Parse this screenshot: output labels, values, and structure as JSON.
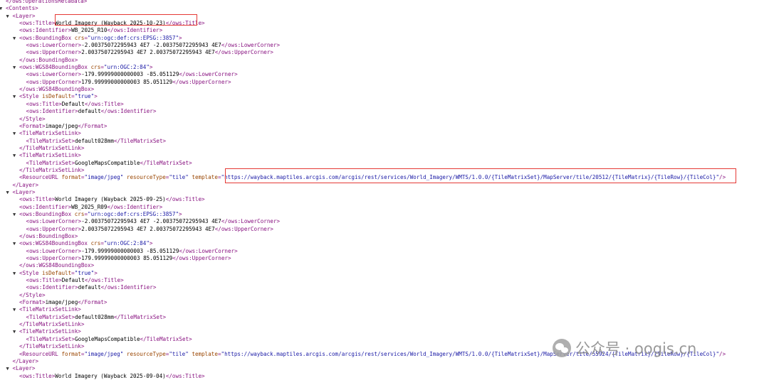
{
  "colors": {
    "tag": "#881280",
    "attribute": "#994500",
    "attribute_value": "#1a1aa6",
    "text": "#000000",
    "highlight": "#e53935"
  },
  "watermark": {
    "icon": "wechat-icon",
    "text": "公众号 · oogis.cn"
  },
  "lines": [
    {
      "indent": 0,
      "arrow": "",
      "tokens": [
        {
          "t": "tag",
          "v": "</ows:OperationsMetadata>"
        }
      ]
    },
    {
      "indent": 0,
      "arrow": "▼",
      "tokens": [
        {
          "t": "tag",
          "v": "<Contents>"
        }
      ]
    },
    {
      "indent": 1,
      "arrow": "▼",
      "tokens": [
        {
          "t": "tag",
          "v": "<Layer>"
        }
      ]
    },
    {
      "indent": 2,
      "arrow": "",
      "tokens": [
        {
          "t": "tag",
          "v": "<ows:Title>"
        },
        {
          "t": "txt",
          "v": "World Imagery (Wayback 2025-10-23)"
        },
        {
          "t": "tag",
          "v": "</ows:Title>"
        }
      ]
    },
    {
      "indent": 2,
      "arrow": "",
      "tokens": [
        {
          "t": "tag",
          "v": "<ows:Identifier>"
        },
        {
          "t": "txt",
          "v": "WB_2025_R10"
        },
        {
          "t": "tag",
          "v": "</ows:Identifier>"
        }
      ]
    },
    {
      "indent": 2,
      "arrow": "▼",
      "tokens": [
        {
          "t": "tag",
          "v": "<ows:BoundingBox "
        },
        {
          "t": "attr",
          "v": "crs"
        },
        {
          "t": "tag",
          "v": "="
        },
        {
          "t": "val",
          "v": "\"urn:ogc:def:crs:EPSG::3857\""
        },
        {
          "t": "tag",
          "v": ">"
        }
      ]
    },
    {
      "indent": 3,
      "arrow": "",
      "tokens": [
        {
          "t": "tag",
          "v": "<ows:LowerCorner>"
        },
        {
          "t": "txt",
          "v": "-2.00375072295943 4E7 -2.00375072295943 4E7"
        },
        {
          "t": "tag",
          "v": "</ows:LowerCorner>"
        }
      ]
    },
    {
      "indent": 3,
      "arrow": "",
      "tokens": [
        {
          "t": "tag",
          "v": "<ows:UpperCorner>"
        },
        {
          "t": "txt",
          "v": "2.00375072295943 4E7 2.00375072295943 4E7"
        },
        {
          "t": "tag",
          "v": "</ows:UpperCorner>"
        }
      ]
    },
    {
      "indent": 2,
      "arrow": "",
      "tokens": [
        {
          "t": "tag",
          "v": "</ows:BoundingBox>"
        }
      ]
    },
    {
      "indent": 2,
      "arrow": "▼",
      "tokens": [
        {
          "t": "tag",
          "v": "<ows:WGS84BoundingBox "
        },
        {
          "t": "attr",
          "v": "crs"
        },
        {
          "t": "tag",
          "v": "="
        },
        {
          "t": "val",
          "v": "\"urn:OGC:2:84\""
        },
        {
          "t": "tag",
          "v": ">"
        }
      ]
    },
    {
      "indent": 3,
      "arrow": "",
      "tokens": [
        {
          "t": "tag",
          "v": "<ows:LowerCorner>"
        },
        {
          "t": "txt",
          "v": "-179.99999000000003 -85.051129"
        },
        {
          "t": "tag",
          "v": "</ows:LowerCorner>"
        }
      ]
    },
    {
      "indent": 3,
      "arrow": "",
      "tokens": [
        {
          "t": "tag",
          "v": "<ows:UpperCorner>"
        },
        {
          "t": "txt",
          "v": "179.99999000000003 85.051129"
        },
        {
          "t": "tag",
          "v": "</ows:UpperCorner>"
        }
      ]
    },
    {
      "indent": 2,
      "arrow": "",
      "tokens": [
        {
          "t": "tag",
          "v": "</ows:WGS84BoundingBox>"
        }
      ]
    },
    {
      "indent": 2,
      "arrow": "▼",
      "tokens": [
        {
          "t": "tag",
          "v": "<Style "
        },
        {
          "t": "attr",
          "v": "isDefault"
        },
        {
          "t": "tag",
          "v": "="
        },
        {
          "t": "val",
          "v": "\"true\""
        },
        {
          "t": "tag",
          "v": ">"
        }
      ]
    },
    {
      "indent": 3,
      "arrow": "",
      "tokens": [
        {
          "t": "tag",
          "v": "<ows:Title>"
        },
        {
          "t": "txt",
          "v": "Default"
        },
        {
          "t": "tag",
          "v": "</ows:Title>"
        }
      ]
    },
    {
      "indent": 3,
      "arrow": "",
      "tokens": [
        {
          "t": "tag",
          "v": "<ows:Identifier>"
        },
        {
          "t": "txt",
          "v": "default"
        },
        {
          "t": "tag",
          "v": "</ows:Identifier>"
        }
      ]
    },
    {
      "indent": 2,
      "arrow": "",
      "tokens": [
        {
          "t": "tag",
          "v": "</Style>"
        }
      ]
    },
    {
      "indent": 2,
      "arrow": "",
      "tokens": [
        {
          "t": "tag",
          "v": "<Format>"
        },
        {
          "t": "txt",
          "v": "image/jpeg"
        },
        {
          "t": "tag",
          "v": "</Format>"
        }
      ]
    },
    {
      "indent": 2,
      "arrow": "▼",
      "tokens": [
        {
          "t": "tag",
          "v": "<TileMatrixSetLink>"
        }
      ]
    },
    {
      "indent": 3,
      "arrow": "",
      "tokens": [
        {
          "t": "tag",
          "v": "<TileMatrixSet>"
        },
        {
          "t": "txt",
          "v": "default028mm"
        },
        {
          "t": "tag",
          "v": "</TileMatrixSet>"
        }
      ]
    },
    {
      "indent": 2,
      "arrow": "",
      "tokens": [
        {
          "t": "tag",
          "v": "</TileMatrixSetLink>"
        }
      ]
    },
    {
      "indent": 2,
      "arrow": "▼",
      "tokens": [
        {
          "t": "tag",
          "v": "<TileMatrixSetLink>"
        }
      ]
    },
    {
      "indent": 3,
      "arrow": "",
      "tokens": [
        {
          "t": "tag",
          "v": "<TileMatrixSet>"
        },
        {
          "t": "txt",
          "v": "GoogleMapsCompatible"
        },
        {
          "t": "tag",
          "v": "</TileMatrixSet>"
        }
      ]
    },
    {
      "indent": 2,
      "arrow": "",
      "tokens": [
        {
          "t": "tag",
          "v": "</TileMatrixSetLink>"
        }
      ]
    },
    {
      "indent": 2,
      "arrow": "",
      "tokens": [
        {
          "t": "tag",
          "v": "<ResourceURL "
        },
        {
          "t": "attr",
          "v": "format"
        },
        {
          "t": "tag",
          "v": "="
        },
        {
          "t": "val",
          "v": "\"image/jpeg\""
        },
        {
          "t": "tag",
          "v": " "
        },
        {
          "t": "attr",
          "v": "resourceType"
        },
        {
          "t": "tag",
          "v": "="
        },
        {
          "t": "val",
          "v": "\"tile\""
        },
        {
          "t": "tag",
          "v": " "
        },
        {
          "t": "attr",
          "v": "template"
        },
        {
          "t": "tag",
          "v": "="
        },
        {
          "t": "val",
          "v": "\"https://wayback.maptiles.arcgis.com/arcgis/rest/services/World_Imagery/WMTS/1.0.0/{TileMatrixSet}/MapServer/tile/20512/{TileMatrix}/{TileRow}/{TileCol}\""
        },
        {
          "t": "tag",
          "v": "/>"
        }
      ]
    },
    {
      "indent": 1,
      "arrow": "",
      "tokens": [
        {
          "t": "tag",
          "v": "</Layer>"
        }
      ]
    },
    {
      "indent": 1,
      "arrow": "▼",
      "tokens": [
        {
          "t": "tag",
          "v": "<Layer>"
        }
      ]
    },
    {
      "indent": 2,
      "arrow": "",
      "tokens": [
        {
          "t": "tag",
          "v": "<ows:Title>"
        },
        {
          "t": "txt",
          "v": "World Imagery (Wayback 2025-09-25)"
        },
        {
          "t": "tag",
          "v": "</ows:Title>"
        }
      ]
    },
    {
      "indent": 2,
      "arrow": "",
      "tokens": [
        {
          "t": "tag",
          "v": "<ows:Identifier>"
        },
        {
          "t": "txt",
          "v": "WB_2025_R09"
        },
        {
          "t": "tag",
          "v": "</ows:Identifier>"
        }
      ]
    },
    {
      "indent": 2,
      "arrow": "▼",
      "tokens": [
        {
          "t": "tag",
          "v": "<ows:BoundingBox "
        },
        {
          "t": "attr",
          "v": "crs"
        },
        {
          "t": "tag",
          "v": "="
        },
        {
          "t": "val",
          "v": "\"urn:ogc:def:crs:EPSG::3857\""
        },
        {
          "t": "tag",
          "v": ">"
        }
      ]
    },
    {
      "indent": 3,
      "arrow": "",
      "tokens": [
        {
          "t": "tag",
          "v": "<ows:LowerCorner>"
        },
        {
          "t": "txt",
          "v": "-2.00375072295943 4E7 -2.00375072295943 4E7"
        },
        {
          "t": "tag",
          "v": "</ows:LowerCorner>"
        }
      ]
    },
    {
      "indent": 3,
      "arrow": "",
      "tokens": [
        {
          "t": "tag",
          "v": "<ows:UpperCorner>"
        },
        {
          "t": "txt",
          "v": "2.00375072295943 4E7 2.00375072295943 4E7"
        },
        {
          "t": "tag",
          "v": "</ows:UpperCorner>"
        }
      ]
    },
    {
      "indent": 2,
      "arrow": "",
      "tokens": [
        {
          "t": "tag",
          "v": "</ows:BoundingBox>"
        }
      ]
    },
    {
      "indent": 2,
      "arrow": "▼",
      "tokens": [
        {
          "t": "tag",
          "v": "<ows:WGS84BoundingBox "
        },
        {
          "t": "attr",
          "v": "crs"
        },
        {
          "t": "tag",
          "v": "="
        },
        {
          "t": "val",
          "v": "\"urn:OGC:2:84\""
        },
        {
          "t": "tag",
          "v": ">"
        }
      ]
    },
    {
      "indent": 3,
      "arrow": "",
      "tokens": [
        {
          "t": "tag",
          "v": "<ows:LowerCorner>"
        },
        {
          "t": "txt",
          "v": "-179.99999000000003 -85.051129"
        },
        {
          "t": "tag",
          "v": "</ows:LowerCorner>"
        }
      ]
    },
    {
      "indent": 3,
      "arrow": "",
      "tokens": [
        {
          "t": "tag",
          "v": "<ows:UpperCorner>"
        },
        {
          "t": "txt",
          "v": "179.99999000000003 85.051129"
        },
        {
          "t": "tag",
          "v": "</ows:UpperCorner>"
        }
      ]
    },
    {
      "indent": 2,
      "arrow": "",
      "tokens": [
        {
          "t": "tag",
          "v": "</ows:WGS84BoundingBox>"
        }
      ]
    },
    {
      "indent": 2,
      "arrow": "▼",
      "tokens": [
        {
          "t": "tag",
          "v": "<Style "
        },
        {
          "t": "attr",
          "v": "isDefault"
        },
        {
          "t": "tag",
          "v": "="
        },
        {
          "t": "val",
          "v": "\"true\""
        },
        {
          "t": "tag",
          "v": ">"
        }
      ]
    },
    {
      "indent": 3,
      "arrow": "",
      "tokens": [
        {
          "t": "tag",
          "v": "<ows:Title>"
        },
        {
          "t": "txt",
          "v": "Default"
        },
        {
          "t": "tag",
          "v": "</ows:Title>"
        }
      ]
    },
    {
      "indent": 3,
      "arrow": "",
      "tokens": [
        {
          "t": "tag",
          "v": "<ows:Identifier>"
        },
        {
          "t": "txt",
          "v": "default"
        },
        {
          "t": "tag",
          "v": "</ows:Identifier>"
        }
      ]
    },
    {
      "indent": 2,
      "arrow": "",
      "tokens": [
        {
          "t": "tag",
          "v": "</Style>"
        }
      ]
    },
    {
      "indent": 2,
      "arrow": "",
      "tokens": [
        {
          "t": "tag",
          "v": "<Format>"
        },
        {
          "t": "txt",
          "v": "image/jpeg"
        },
        {
          "t": "tag",
          "v": "</Format>"
        }
      ]
    },
    {
      "indent": 2,
      "arrow": "▼",
      "tokens": [
        {
          "t": "tag",
          "v": "<TileMatrixSetLink>"
        }
      ]
    },
    {
      "indent": 3,
      "arrow": "",
      "tokens": [
        {
          "t": "tag",
          "v": "<TileMatrixSet>"
        },
        {
          "t": "txt",
          "v": "default028mm"
        },
        {
          "t": "tag",
          "v": "</TileMatrixSet>"
        }
      ]
    },
    {
      "indent": 2,
      "arrow": "",
      "tokens": [
        {
          "t": "tag",
          "v": "</TileMatrixSetLink>"
        }
      ]
    },
    {
      "indent": 2,
      "arrow": "▼",
      "tokens": [
        {
          "t": "tag",
          "v": "<TileMatrixSetLink>"
        }
      ]
    },
    {
      "indent": 3,
      "arrow": "",
      "tokens": [
        {
          "t": "tag",
          "v": "<TileMatrixSet>"
        },
        {
          "t": "txt",
          "v": "GoogleMapsCompatible"
        },
        {
          "t": "tag",
          "v": "</TileMatrixSet>"
        }
      ]
    },
    {
      "indent": 2,
      "arrow": "",
      "tokens": [
        {
          "t": "tag",
          "v": "</TileMatrixSetLink>"
        }
      ]
    },
    {
      "indent": 2,
      "arrow": "",
      "tokens": [
        {
          "t": "tag",
          "v": "<ResourceURL "
        },
        {
          "t": "attr",
          "v": "format"
        },
        {
          "t": "tag",
          "v": "="
        },
        {
          "t": "val",
          "v": "\"image/jpeg\""
        },
        {
          "t": "tag",
          "v": " "
        },
        {
          "t": "attr",
          "v": "resourceType"
        },
        {
          "t": "tag",
          "v": "="
        },
        {
          "t": "val",
          "v": "\"tile\""
        },
        {
          "t": "tag",
          "v": " "
        },
        {
          "t": "attr",
          "v": "template"
        },
        {
          "t": "tag",
          "v": "="
        },
        {
          "t": "val",
          "v": "\"https://wayback.maptiles.arcgis.com/arcgis/rest/services/World_Imagery/WMTS/1.0.0/{TileMatrixSet}/MapServer/tile/55924/{TileMatrix}/{TileRow}/{TileCol}\""
        },
        {
          "t": "tag",
          "v": "/>"
        }
      ]
    },
    {
      "indent": 1,
      "arrow": "",
      "tokens": [
        {
          "t": "tag",
          "v": "</Layer>"
        }
      ]
    },
    {
      "indent": 1,
      "arrow": "▼",
      "tokens": [
        {
          "t": "tag",
          "v": "<Layer>"
        }
      ]
    },
    {
      "indent": 2,
      "arrow": "",
      "tokens": [
        {
          "t": "tag",
          "v": "<ows:Title>"
        },
        {
          "t": "txt",
          "v": "World Imagery (Wayback 2025-09-04)"
        },
        {
          "t": "tag",
          "v": "</ows:Title>"
        }
      ]
    }
  ]
}
